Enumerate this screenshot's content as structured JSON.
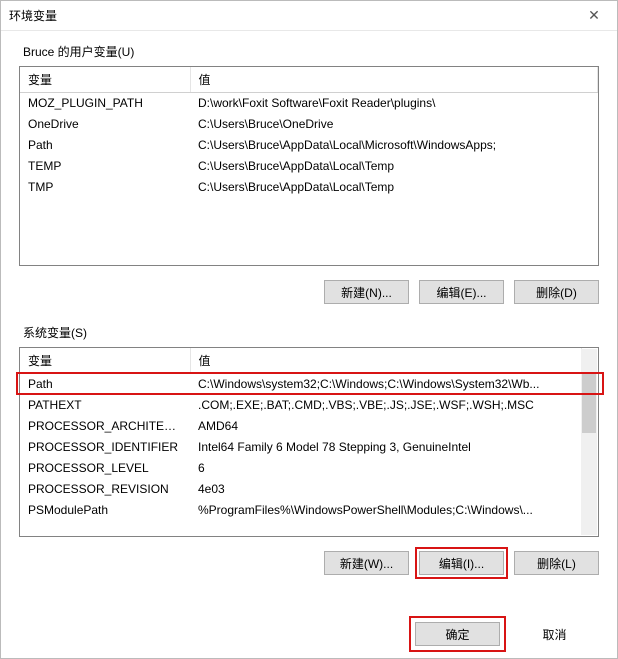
{
  "window": {
    "title": "环境变量"
  },
  "user_section": {
    "label": "Bruce 的用户变量(U)",
    "columns": {
      "var": "变量",
      "val": "值"
    },
    "rows": [
      {
        "var": "MOZ_PLUGIN_PATH",
        "val": "D:\\work\\Foxit Software\\Foxit Reader\\plugins\\"
      },
      {
        "var": "OneDrive",
        "val": "C:\\Users\\Bruce\\OneDrive"
      },
      {
        "var": "Path",
        "val": "C:\\Users\\Bruce\\AppData\\Local\\Microsoft\\WindowsApps;"
      },
      {
        "var": "TEMP",
        "val": "C:\\Users\\Bruce\\AppData\\Local\\Temp"
      },
      {
        "var": "TMP",
        "val": "C:\\Users\\Bruce\\AppData\\Local\\Temp"
      }
    ],
    "buttons": {
      "new": "新建(N)...",
      "edit": "编辑(E)...",
      "delete": "删除(D)"
    }
  },
  "system_section": {
    "label": "系统变量(S)",
    "columns": {
      "var": "变量",
      "val": "值"
    },
    "rows": [
      {
        "var": "Path",
        "val": "C:\\Windows\\system32;C:\\Windows;C:\\Windows\\System32\\Wb..."
      },
      {
        "var": "PATHEXT",
        "val": ".COM;.EXE;.BAT;.CMD;.VBS;.VBE;.JS;.JSE;.WSF;.WSH;.MSC"
      },
      {
        "var": "PROCESSOR_ARCHITECT...",
        "val": "AMD64"
      },
      {
        "var": "PROCESSOR_IDENTIFIER",
        "val": "Intel64 Family 6 Model 78 Stepping 3, GenuineIntel"
      },
      {
        "var": "PROCESSOR_LEVEL",
        "val": "6"
      },
      {
        "var": "PROCESSOR_REVISION",
        "val": "4e03"
      },
      {
        "var": "PSModulePath",
        "val": "%ProgramFiles%\\WindowsPowerShell\\Modules;C:\\Windows\\..."
      }
    ],
    "buttons": {
      "new": "新建(W)...",
      "edit": "编辑(I)...",
      "delete": "删除(L)"
    }
  },
  "dialog_buttons": {
    "ok": "确定",
    "cancel": "取消"
  }
}
